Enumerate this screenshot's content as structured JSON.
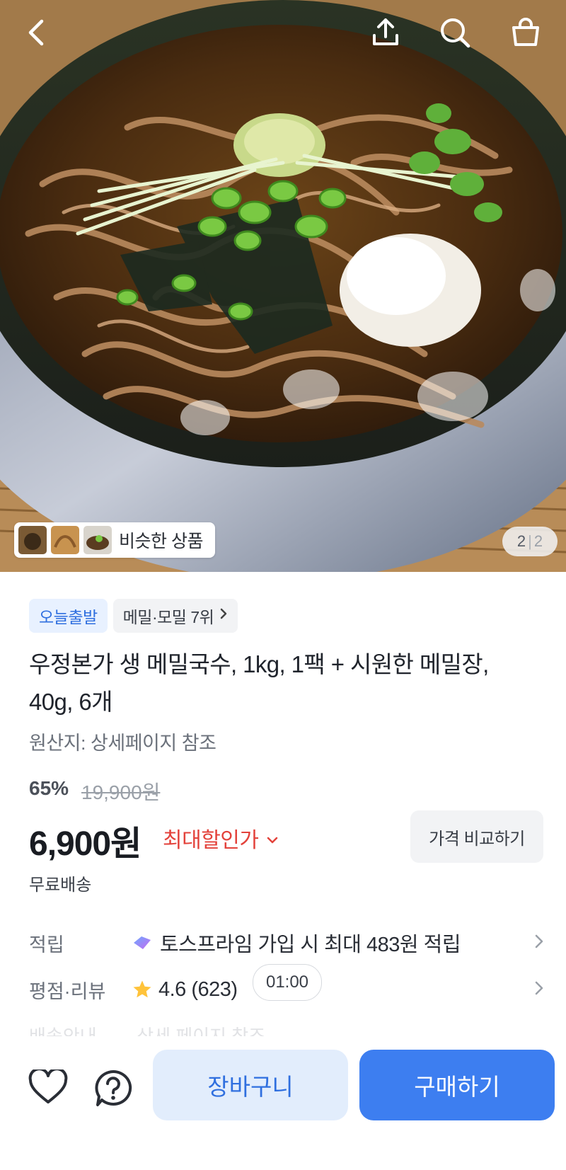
{
  "gallery": {
    "similar_label": "비슷한 상품",
    "current_index": "2",
    "separator": "|",
    "total": "2"
  },
  "header_icons": [
    "back-icon",
    "share-icon",
    "search-icon",
    "cart-icon"
  ],
  "badges": {
    "today_ship": "오늘출발",
    "rank": "메밀·모밀 7위"
  },
  "product": {
    "title": "우정본가 생 메밀국수, 1kg, 1팩 + 시원한 메밀장, 40g, 6개",
    "origin": "원산지: 상세페이지 참조",
    "discount_rate": "65%",
    "original_price": "19,900원",
    "price": "6,900원",
    "max_discount_label": "최대할인가",
    "compare_label": "가격 비교하기",
    "shipping": "무료배송"
  },
  "points": {
    "label": "적립",
    "value": "토스프라임 가입 시 최대 483원 적립"
  },
  "reviews": {
    "label": "평점·리뷰",
    "value": "4.6 (623)",
    "timer": "01:00"
  },
  "delivery_faded": {
    "label": "배송안내",
    "value": "상세 페이지 참조"
  },
  "actions": {
    "cart": "장바구니",
    "buy": "구매하기"
  },
  "colors": {
    "accent": "#3d7ef0",
    "accent_light": "#e2edfc",
    "sale_red": "#e3423b"
  }
}
